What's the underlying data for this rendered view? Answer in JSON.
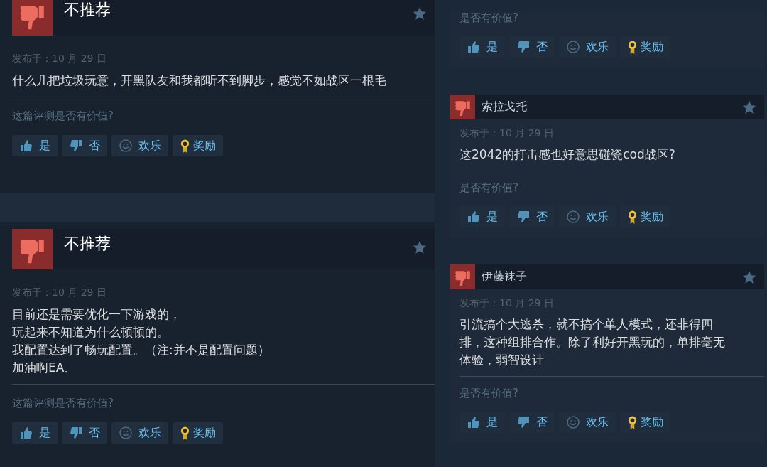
{
  "left_reviews": [
    {
      "header": {
        "kind": "verdict",
        "text": "不推荐"
      },
      "posted": "发布于：10 月 29 日",
      "body": [
        "什么几把垃圾玩意，开黑队友和我都听不到脚步，感觉不如战区一根毛"
      ],
      "helpful_prompt": "这篇评测是否有价值?",
      "actions": [
        {
          "kind": "yes",
          "label": "是"
        },
        {
          "kind": "no",
          "label": "否"
        },
        {
          "kind": "funny",
          "label": "欢乐"
        },
        {
          "kind": "award",
          "label": "奖励"
        }
      ]
    },
    {
      "header": {
        "kind": "verdict",
        "text": "不推荐"
      },
      "posted": "发布于：10 月 29 日",
      "body": [
        "目前还是需要优化一下游戏的，",
        "玩起来不知道为什么顿顿的。",
        "我配置达到了畅玩配置。（注:并不是配置问题）",
        "加油啊EA、"
      ],
      "helpful_prompt": "这篇评测是否有价值?",
      "actions": [
        {
          "kind": "yes",
          "label": "是"
        },
        {
          "kind": "no",
          "label": "否"
        },
        {
          "kind": "funny",
          "label": "欢乐"
        },
        {
          "kind": "award",
          "label": "奖励"
        }
      ]
    }
  ],
  "right_reviews": [
    {
      "helpful_prompt": "是否有价值?",
      "actions": [
        {
          "kind": "yes",
          "label": "是"
        },
        {
          "kind": "no",
          "label": "否"
        },
        {
          "kind": "funny",
          "label": "欢乐"
        },
        {
          "kind": "award",
          "label": "奖励"
        }
      ]
    },
    {
      "header": {
        "kind": "user",
        "text": "索拉戈托"
      },
      "posted": "发布于：10 月 29 日",
      "body": [
        "这2042的打击感也好意思碰瓷cod战区?"
      ],
      "helpful_prompt": "是否有价值?",
      "actions": [
        {
          "kind": "yes",
          "label": "是"
        },
        {
          "kind": "no",
          "label": "否"
        },
        {
          "kind": "funny",
          "label": "欢乐"
        },
        {
          "kind": "award",
          "label": "奖励"
        }
      ]
    },
    {
      "header": {
        "kind": "user",
        "text": "伊藤袜子"
      },
      "posted": "发布于：10 月 29 日",
      "body": [
        "引流搞个大逃杀，就不搞个单人模式，还非得四",
        "排，这种组排合作。除了利好开黑玩的，单排毫无",
        "体验，弱智设计"
      ],
      "helpful_prompt": "是否有价值?",
      "actions": [
        {
          "kind": "yes",
          "label": "是"
        },
        {
          "kind": "no",
          "label": "否"
        },
        {
          "kind": "funny",
          "label": "欢乐"
        },
        {
          "kind": "award",
          "label": "奖励"
        }
      ]
    }
  ]
}
